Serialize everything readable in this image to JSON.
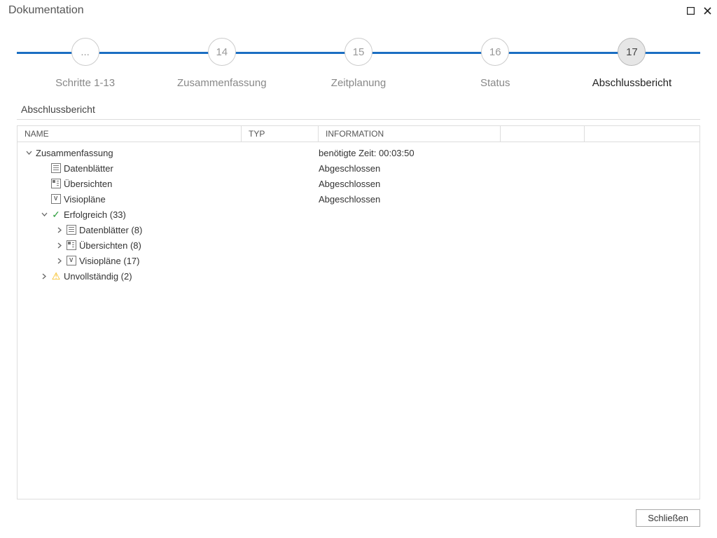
{
  "window": {
    "title": "Dokumentation"
  },
  "stepper": {
    "steps": [
      {
        "num": "...",
        "label": "Schritte 1-13"
      },
      {
        "num": "14",
        "label": "Zusammenfassung"
      },
      {
        "num": "15",
        "label": "Zeitplanung"
      },
      {
        "num": "16",
        "label": "Status"
      },
      {
        "num": "17",
        "label": "Abschlussbericht"
      }
    ]
  },
  "section": {
    "title": "Abschlussbericht",
    "columns": {
      "name": "Name",
      "typ": "Typ",
      "info": "Information"
    }
  },
  "tree": {
    "root": {
      "label": "Zusammenfassung",
      "info": "benötigte Zeit: 00:03:50"
    },
    "items": [
      {
        "label": "Datenblätter",
        "info": "Abgeschlossen"
      },
      {
        "label": "Übersichten",
        "info": "Abgeschlossen"
      },
      {
        "label": "Visiopläne",
        "info": "Abgeschlossen"
      }
    ],
    "success": {
      "label": "Erfolgreich (33)",
      "children": [
        {
          "label": "Datenblätter (8)"
        },
        {
          "label": "Übersichten (8)"
        },
        {
          "label": "Visiopläne (17)"
        }
      ]
    },
    "incomplete": {
      "label": "Unvollständig (2)"
    }
  },
  "footer": {
    "close": "Schließen"
  }
}
